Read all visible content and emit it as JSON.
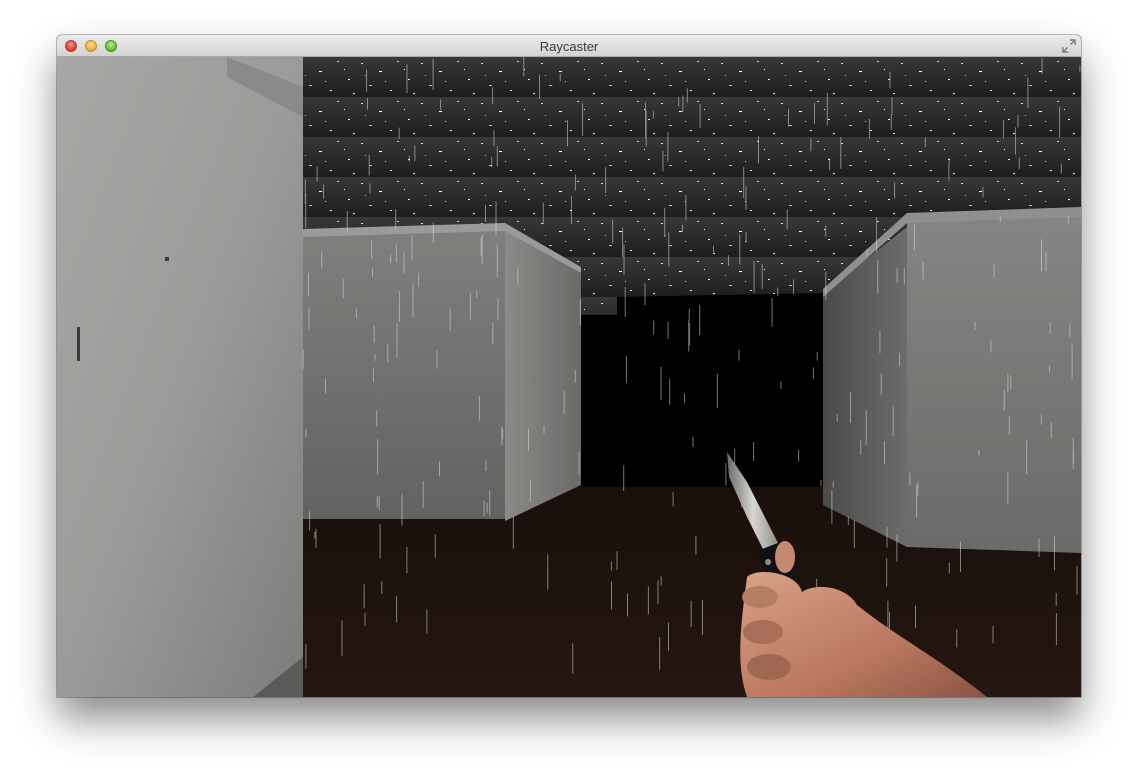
{
  "window": {
    "title": "Raycaster"
  },
  "icons": {
    "close": "close-traffic-light",
    "minimize": "minimize-traffic-light",
    "zoom": "zoom-traffic-light",
    "fullscreen": "fullscreen-arrows-icon"
  },
  "colors": {
    "ceiling": "#2a2826",
    "floor": "#1a100b",
    "wall": "#8e8f8c",
    "darkness": "#000000",
    "skin": "#c98a6c"
  }
}
